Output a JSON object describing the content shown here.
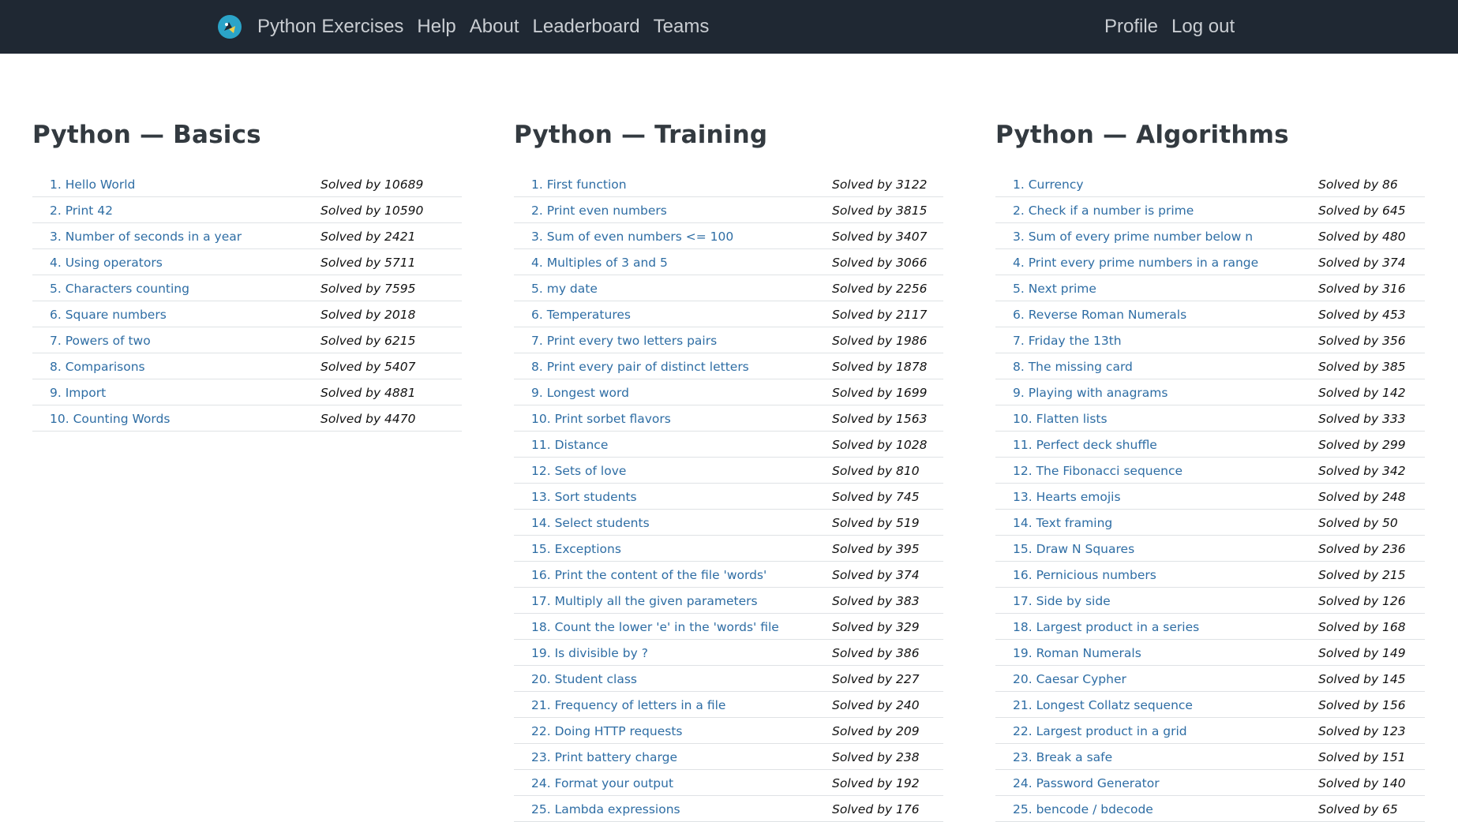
{
  "navbar": {
    "left_links": [
      "Python Exercises",
      "Help",
      "About",
      "Leaderboard",
      "Teams"
    ],
    "right_links": [
      "Profile",
      "Log out"
    ],
    "colors": {
      "background": "#1f2833",
      "link": "#c9cdd2"
    }
  },
  "columns": [
    {
      "title": "Python — Basics",
      "exercises": [
        {
          "label": "1. Hello World",
          "solved": "Solved by 10689"
        },
        {
          "label": "2. Print 42",
          "solved": "Solved by 10590"
        },
        {
          "label": "3. Number of seconds in a year",
          "solved": "Solved by 2421"
        },
        {
          "label": "4. Using operators",
          "solved": "Solved by 5711"
        },
        {
          "label": "5. Characters counting",
          "solved": "Solved by 7595"
        },
        {
          "label": "6. Square numbers",
          "solved": "Solved by 2018"
        },
        {
          "label": "7. Powers of two",
          "solved": "Solved by 6215"
        },
        {
          "label": "8. Comparisons",
          "solved": "Solved by 5407"
        },
        {
          "label": "9. Import",
          "solved": "Solved by 4881"
        },
        {
          "label": "10. Counting Words",
          "solved": "Solved by 4470"
        }
      ]
    },
    {
      "title": "Python — Training",
      "exercises": [
        {
          "label": "1. First function",
          "solved": "Solved by 3122"
        },
        {
          "label": "2. Print even numbers",
          "solved": "Solved by 3815"
        },
        {
          "label": "3. Sum of even numbers <= 100",
          "solved": "Solved by 3407"
        },
        {
          "label": "4. Multiples of 3 and 5",
          "solved": "Solved by 3066"
        },
        {
          "label": "5. my date",
          "solved": "Solved by 2256"
        },
        {
          "label": "6. Temperatures",
          "solved": "Solved by 2117"
        },
        {
          "label": "7. Print every two letters pairs",
          "solved": "Solved by 1986"
        },
        {
          "label": "8. Print every pair of distinct letters",
          "solved": "Solved by 1878"
        },
        {
          "label": "9. Longest word",
          "solved": "Solved by 1699"
        },
        {
          "label": "10. Print sorbet flavors",
          "solved": "Solved by 1563"
        },
        {
          "label": "11. Distance",
          "solved": "Solved by 1028"
        },
        {
          "label": "12. Sets of love",
          "solved": "Solved by 810"
        },
        {
          "label": "13. Sort students",
          "solved": "Solved by 745"
        },
        {
          "label": "14. Select students",
          "solved": "Solved by 519"
        },
        {
          "label": "15. Exceptions",
          "solved": "Solved by 395"
        },
        {
          "label": "16. Print the content of the file 'words'",
          "solved": "Solved by 374"
        },
        {
          "label": "17. Multiply all the given parameters",
          "solved": "Solved by 383"
        },
        {
          "label": "18. Count the lower 'e' in the 'words' file",
          "solved": "Solved by 329"
        },
        {
          "label": "19. Is divisible by ?",
          "solved": "Solved by 386"
        },
        {
          "label": "20. Student class",
          "solved": "Solved by 227"
        },
        {
          "label": "21. Frequency of letters in a file",
          "solved": "Solved by 240"
        },
        {
          "label": "22. Doing HTTP requests",
          "solved": "Solved by 209"
        },
        {
          "label": "23. Print battery charge",
          "solved": "Solved by 238"
        },
        {
          "label": "24. Format your output",
          "solved": "Solved by 192"
        },
        {
          "label": "25. Lambda expressions",
          "solved": "Solved by 176"
        }
      ]
    },
    {
      "title": "Python — Algorithms",
      "exercises": [
        {
          "label": "1. Currency",
          "solved": "Solved by 86"
        },
        {
          "label": "2. Check if a number is prime",
          "solved": "Solved by 645"
        },
        {
          "label": "3. Sum of every prime number below n",
          "solved": "Solved by 480"
        },
        {
          "label": "4. Print every prime numbers in a range",
          "solved": "Solved by 374"
        },
        {
          "label": "5. Next prime",
          "solved": "Solved by 316"
        },
        {
          "label": "6. Reverse Roman Numerals",
          "solved": "Solved by 453"
        },
        {
          "label": "7. Friday the 13th",
          "solved": "Solved by 356"
        },
        {
          "label": "8. The missing card",
          "solved": "Solved by 385"
        },
        {
          "label": "9. Playing with anagrams",
          "solved": "Solved by 142"
        },
        {
          "label": "10. Flatten lists",
          "solved": "Solved by 333"
        },
        {
          "label": "11. Perfect deck shuffle",
          "solved": "Solved by 299"
        },
        {
          "label": "12. The Fibonacci sequence",
          "solved": "Solved by 342"
        },
        {
          "label": "13. Hearts emojis",
          "solved": "Solved by 248"
        },
        {
          "label": "14. Text framing",
          "solved": "Solved by 50"
        },
        {
          "label": "15. Draw N Squares",
          "solved": "Solved by 236"
        },
        {
          "label": "16. Pernicious numbers",
          "solved": "Solved by 215"
        },
        {
          "label": "17. Side by side",
          "solved": "Solved by 126"
        },
        {
          "label": "18. Largest product in a series",
          "solved": "Solved by 168"
        },
        {
          "label": "19. Roman Numerals",
          "solved": "Solved by 149"
        },
        {
          "label": "20. Caesar Cypher",
          "solved": "Solved by 145"
        },
        {
          "label": "21. Longest Collatz sequence",
          "solved": "Solved by 156"
        },
        {
          "label": "22. Largest product in a grid",
          "solved": "Solved by 123"
        },
        {
          "label": "23. Break a safe",
          "solved": "Solved by 151"
        },
        {
          "label": "24. Password Generator",
          "solved": "Solved by 140"
        },
        {
          "label": "25. bencode / bdecode",
          "solved": "Solved by 65"
        }
      ]
    }
  ]
}
